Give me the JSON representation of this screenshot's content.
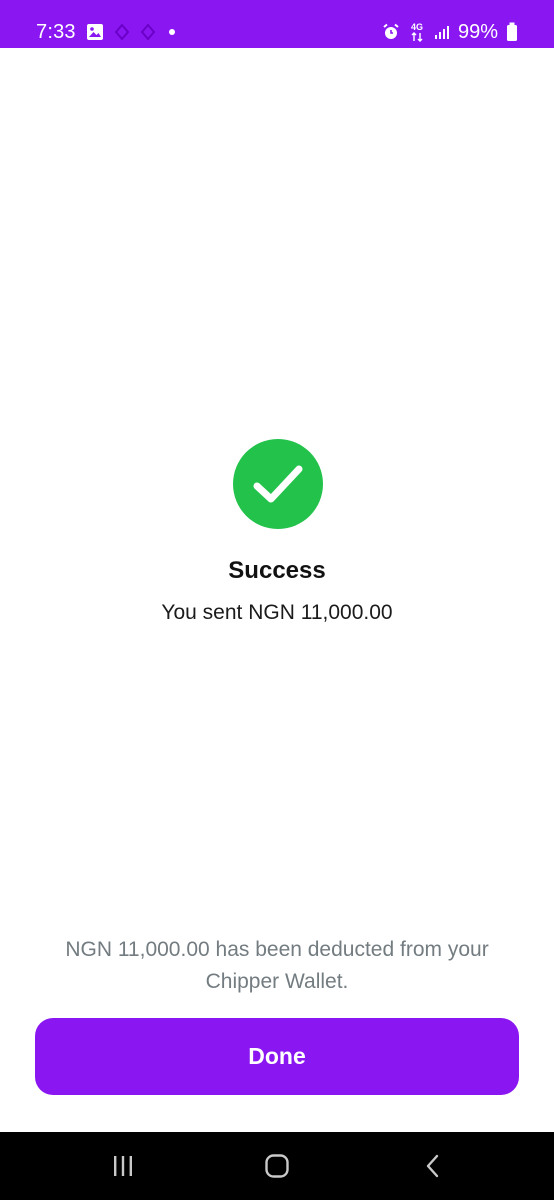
{
  "status_bar": {
    "time": "7:33",
    "battery_percent": "99%",
    "network": "4G",
    "background_color": "#8a16f2",
    "icons": [
      "gallery-icon",
      "app-notification-icon",
      "app-notification-icon",
      "dot-icon",
      "alarm-icon",
      "network-4g-icon",
      "signal-icon",
      "battery-icon"
    ]
  },
  "result": {
    "icon": "checkmark-icon",
    "icon_color": "#22c24b",
    "title": "Success",
    "message": "You sent NGN 11,000.00"
  },
  "footer": {
    "note": "NGN 11,000.00 has been deducted from your Chipper Wallet.",
    "done_label": "Done",
    "button_color": "#8a16f2"
  },
  "nav_bar": {
    "icons": [
      "recent-apps-icon",
      "home-icon",
      "back-icon"
    ]
  }
}
